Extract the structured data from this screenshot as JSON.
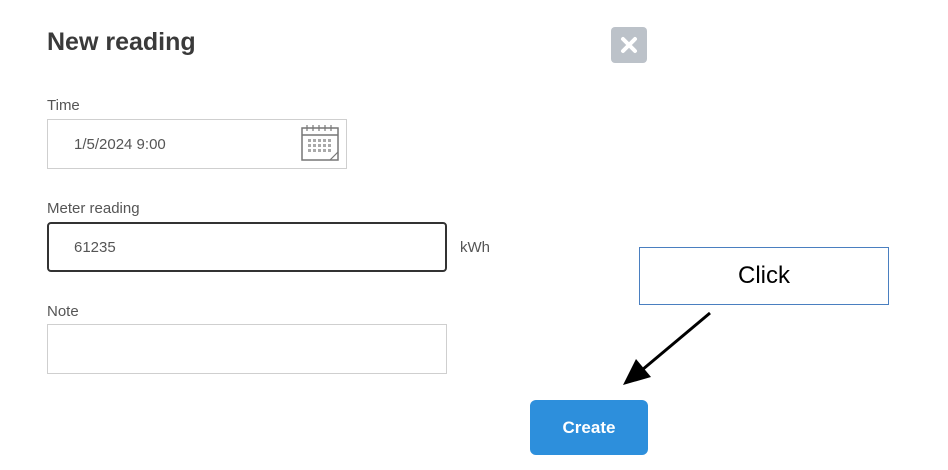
{
  "dialog": {
    "title": "New reading",
    "close_icon": "close-icon",
    "fields": {
      "time": {
        "label": "Time",
        "value": "1/5/2024 9:00",
        "icon": "calendar-icon"
      },
      "meter": {
        "label": "Meter reading",
        "value": "61235",
        "unit": "kWh"
      },
      "note": {
        "label": "Note",
        "value": ""
      }
    },
    "create_label": "Create"
  },
  "annotation": {
    "callout_text": "Click",
    "arrow_icon": "arrow-icon"
  },
  "colors": {
    "primary": "#2d8fdc",
    "close_bg": "#bcc2c9",
    "focus_border": "#333333",
    "callout_border": "#4a7fc0"
  }
}
